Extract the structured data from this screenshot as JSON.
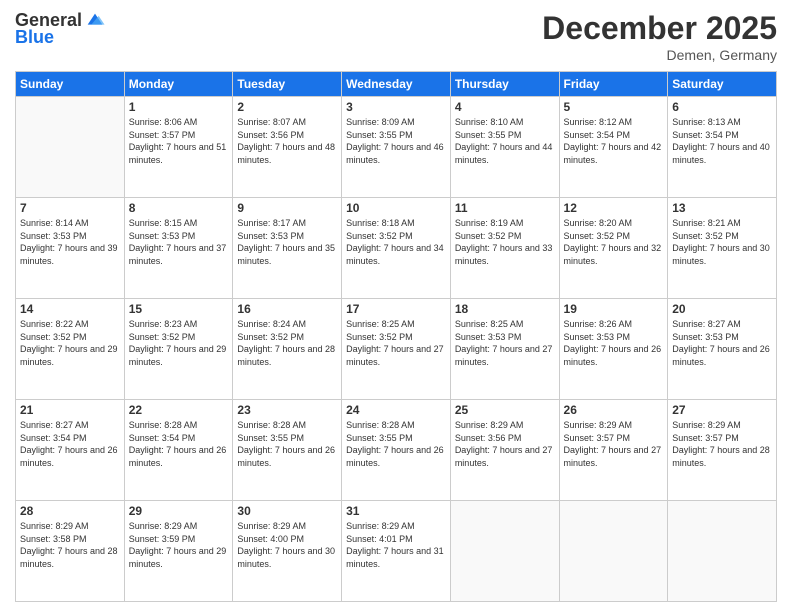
{
  "header": {
    "logo_line1": "General",
    "logo_line2": "Blue",
    "month_title": "December 2025",
    "location": "Demen, Germany"
  },
  "days_of_week": [
    "Sunday",
    "Monday",
    "Tuesday",
    "Wednesday",
    "Thursday",
    "Friday",
    "Saturday"
  ],
  "weeks": [
    [
      {
        "day": "",
        "sunrise": "",
        "sunset": "",
        "daylight": ""
      },
      {
        "day": "1",
        "sunrise": "Sunrise: 8:06 AM",
        "sunset": "Sunset: 3:57 PM",
        "daylight": "Daylight: 7 hours and 51 minutes."
      },
      {
        "day": "2",
        "sunrise": "Sunrise: 8:07 AM",
        "sunset": "Sunset: 3:56 PM",
        "daylight": "Daylight: 7 hours and 48 minutes."
      },
      {
        "day": "3",
        "sunrise": "Sunrise: 8:09 AM",
        "sunset": "Sunset: 3:55 PM",
        "daylight": "Daylight: 7 hours and 46 minutes."
      },
      {
        "day": "4",
        "sunrise": "Sunrise: 8:10 AM",
        "sunset": "Sunset: 3:55 PM",
        "daylight": "Daylight: 7 hours and 44 minutes."
      },
      {
        "day": "5",
        "sunrise": "Sunrise: 8:12 AM",
        "sunset": "Sunset: 3:54 PM",
        "daylight": "Daylight: 7 hours and 42 minutes."
      },
      {
        "day": "6",
        "sunrise": "Sunrise: 8:13 AM",
        "sunset": "Sunset: 3:54 PM",
        "daylight": "Daylight: 7 hours and 40 minutes."
      }
    ],
    [
      {
        "day": "7",
        "sunrise": "Sunrise: 8:14 AM",
        "sunset": "Sunset: 3:53 PM",
        "daylight": "Daylight: 7 hours and 39 minutes."
      },
      {
        "day": "8",
        "sunrise": "Sunrise: 8:15 AM",
        "sunset": "Sunset: 3:53 PM",
        "daylight": "Daylight: 7 hours and 37 minutes."
      },
      {
        "day": "9",
        "sunrise": "Sunrise: 8:17 AM",
        "sunset": "Sunset: 3:53 PM",
        "daylight": "Daylight: 7 hours and 35 minutes."
      },
      {
        "day": "10",
        "sunrise": "Sunrise: 8:18 AM",
        "sunset": "Sunset: 3:52 PM",
        "daylight": "Daylight: 7 hours and 34 minutes."
      },
      {
        "day": "11",
        "sunrise": "Sunrise: 8:19 AM",
        "sunset": "Sunset: 3:52 PM",
        "daylight": "Daylight: 7 hours and 33 minutes."
      },
      {
        "day": "12",
        "sunrise": "Sunrise: 8:20 AM",
        "sunset": "Sunset: 3:52 PM",
        "daylight": "Daylight: 7 hours and 32 minutes."
      },
      {
        "day": "13",
        "sunrise": "Sunrise: 8:21 AM",
        "sunset": "Sunset: 3:52 PM",
        "daylight": "Daylight: 7 hours and 30 minutes."
      }
    ],
    [
      {
        "day": "14",
        "sunrise": "Sunrise: 8:22 AM",
        "sunset": "Sunset: 3:52 PM",
        "daylight": "Daylight: 7 hours and 29 minutes."
      },
      {
        "day": "15",
        "sunrise": "Sunrise: 8:23 AM",
        "sunset": "Sunset: 3:52 PM",
        "daylight": "Daylight: 7 hours and 29 minutes."
      },
      {
        "day": "16",
        "sunrise": "Sunrise: 8:24 AM",
        "sunset": "Sunset: 3:52 PM",
        "daylight": "Daylight: 7 hours and 28 minutes."
      },
      {
        "day": "17",
        "sunrise": "Sunrise: 8:25 AM",
        "sunset": "Sunset: 3:52 PM",
        "daylight": "Daylight: 7 hours and 27 minutes."
      },
      {
        "day": "18",
        "sunrise": "Sunrise: 8:25 AM",
        "sunset": "Sunset: 3:53 PM",
        "daylight": "Daylight: 7 hours and 27 minutes."
      },
      {
        "day": "19",
        "sunrise": "Sunrise: 8:26 AM",
        "sunset": "Sunset: 3:53 PM",
        "daylight": "Daylight: 7 hours and 26 minutes."
      },
      {
        "day": "20",
        "sunrise": "Sunrise: 8:27 AM",
        "sunset": "Sunset: 3:53 PM",
        "daylight": "Daylight: 7 hours and 26 minutes."
      }
    ],
    [
      {
        "day": "21",
        "sunrise": "Sunrise: 8:27 AM",
        "sunset": "Sunset: 3:54 PM",
        "daylight": "Daylight: 7 hours and 26 minutes."
      },
      {
        "day": "22",
        "sunrise": "Sunrise: 8:28 AM",
        "sunset": "Sunset: 3:54 PM",
        "daylight": "Daylight: 7 hours and 26 minutes."
      },
      {
        "day": "23",
        "sunrise": "Sunrise: 8:28 AM",
        "sunset": "Sunset: 3:55 PM",
        "daylight": "Daylight: 7 hours and 26 minutes."
      },
      {
        "day": "24",
        "sunrise": "Sunrise: 8:28 AM",
        "sunset": "Sunset: 3:55 PM",
        "daylight": "Daylight: 7 hours and 26 minutes."
      },
      {
        "day": "25",
        "sunrise": "Sunrise: 8:29 AM",
        "sunset": "Sunset: 3:56 PM",
        "daylight": "Daylight: 7 hours and 27 minutes."
      },
      {
        "day": "26",
        "sunrise": "Sunrise: 8:29 AM",
        "sunset": "Sunset: 3:57 PM",
        "daylight": "Daylight: 7 hours and 27 minutes."
      },
      {
        "day": "27",
        "sunrise": "Sunrise: 8:29 AM",
        "sunset": "Sunset: 3:57 PM",
        "daylight": "Daylight: 7 hours and 28 minutes."
      }
    ],
    [
      {
        "day": "28",
        "sunrise": "Sunrise: 8:29 AM",
        "sunset": "Sunset: 3:58 PM",
        "daylight": "Daylight: 7 hours and 28 minutes."
      },
      {
        "day": "29",
        "sunrise": "Sunrise: 8:29 AM",
        "sunset": "Sunset: 3:59 PM",
        "daylight": "Daylight: 7 hours and 29 minutes."
      },
      {
        "day": "30",
        "sunrise": "Sunrise: 8:29 AM",
        "sunset": "Sunset: 4:00 PM",
        "daylight": "Daylight: 7 hours and 30 minutes."
      },
      {
        "day": "31",
        "sunrise": "Sunrise: 8:29 AM",
        "sunset": "Sunset: 4:01 PM",
        "daylight": "Daylight: 7 hours and 31 minutes."
      },
      {
        "day": "",
        "sunrise": "",
        "sunset": "",
        "daylight": ""
      },
      {
        "day": "",
        "sunrise": "",
        "sunset": "",
        "daylight": ""
      },
      {
        "day": "",
        "sunrise": "",
        "sunset": "",
        "daylight": ""
      }
    ]
  ]
}
